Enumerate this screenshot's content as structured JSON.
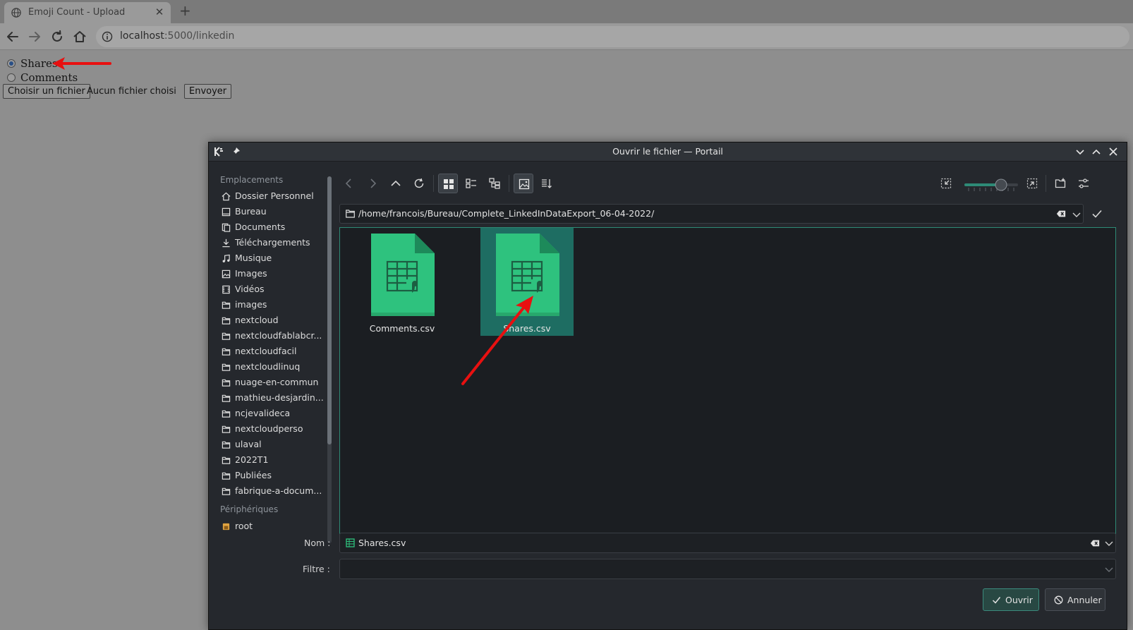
{
  "browser": {
    "tab_title": "Emoji Count - Upload",
    "url_host": "localhost",
    "url_path": ":5000/linkedin"
  },
  "page": {
    "radio_options": [
      {
        "label": "Shares",
        "checked": true
      },
      {
        "label": "Comments",
        "checked": false
      }
    ],
    "file_button": "Choisir un fichier",
    "file_status": "Aucun fichier choisi",
    "submit_button": "Envoyer"
  },
  "dialog": {
    "title": "Ouvrir le fichier — Portail",
    "sidebar_heading_places": "Emplacements",
    "places": [
      {
        "label": "Dossier Personnel",
        "icon": "home-icon"
      },
      {
        "label": "Bureau",
        "icon": "desktop-icon"
      },
      {
        "label": "Documents",
        "icon": "documents-icon"
      },
      {
        "label": "Téléchargements",
        "icon": "download-icon"
      },
      {
        "label": "Musique",
        "icon": "music-icon"
      },
      {
        "label": "Images",
        "icon": "image-icon"
      },
      {
        "label": "Vidéos",
        "icon": "video-icon"
      },
      {
        "label": "images",
        "icon": "folder-icon"
      },
      {
        "label": "nextcloud",
        "icon": "folder-icon"
      },
      {
        "label": "nextcloudfablabcr...",
        "icon": "folder-icon"
      },
      {
        "label": "nextcloudfacil",
        "icon": "folder-icon"
      },
      {
        "label": "nextcloudlinuq",
        "icon": "folder-icon"
      },
      {
        "label": "nuage-en-commun",
        "icon": "folder-icon"
      },
      {
        "label": "mathieu-desjardin...",
        "icon": "folder-icon"
      },
      {
        "label": "ncjevalideca",
        "icon": "folder-icon"
      },
      {
        "label": "nextcloudperso",
        "icon": "folder-icon"
      },
      {
        "label": "ulaval",
        "icon": "folder-icon"
      },
      {
        "label": "2022T1",
        "icon": "folder-icon"
      },
      {
        "label": "Publiées",
        "icon": "folder-icon"
      },
      {
        "label": "fabrique-a-docum...",
        "icon": "folder-icon"
      }
    ],
    "sidebar_heading_devices": "Périphériques",
    "devices": [
      {
        "label": "root",
        "icon": "drive-icon"
      }
    ],
    "path": "/home/francois/Bureau/Complete_LinkedInDataExport_06-04-2022/",
    "files": [
      {
        "name": "Comments.csv",
        "selected": false
      },
      {
        "name": "Shares.csv",
        "selected": true
      }
    ],
    "name_label": "Nom :",
    "name_value": "Shares.csv",
    "filter_label": "Filtre :",
    "filter_value": "",
    "open_button": "Ouvrir",
    "cancel_button": "Annuler"
  },
  "colors": {
    "accent": "#2e8a76",
    "selection": "#1e6d62",
    "csv_icon": "#2ec27e",
    "annotation_arrow": "#e81010"
  }
}
